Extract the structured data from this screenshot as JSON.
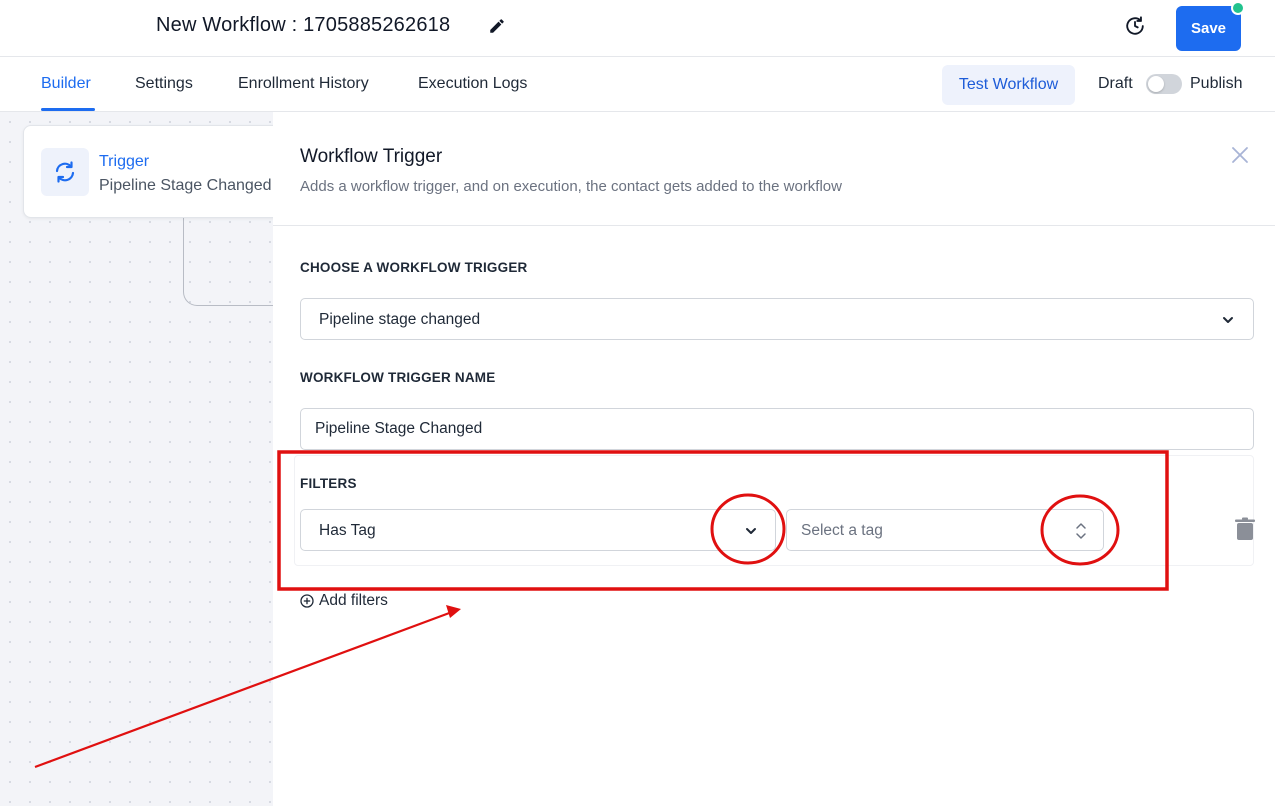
{
  "header": {
    "workflow_title": "New Workflow : 1705885262618",
    "save_label": "Save"
  },
  "tabs": [
    {
      "label": "Builder",
      "active": true
    },
    {
      "label": "Settings",
      "active": false
    },
    {
      "label": "Enrollment History",
      "active": false
    },
    {
      "label": "Execution Logs",
      "active": false
    }
  ],
  "toolbar": {
    "test_workflow_label": "Test Workflow",
    "draft_label": "Draft",
    "publish_label": "Publish",
    "published": false
  },
  "canvas": {
    "trigger_card": {
      "title": "Trigger",
      "subtitle": "Pipeline Stage Changed",
      "icon": "refresh-icon"
    }
  },
  "panel": {
    "title": "Workflow Trigger",
    "description": "Adds a workflow trigger, and on execution, the contact gets added to the workflow",
    "choose_trigger_label": "CHOOSE A WORKFLOW TRIGGER",
    "trigger_value": "Pipeline stage changed",
    "trigger_name_label": "WORKFLOW TRIGGER NAME",
    "trigger_name_value": "Pipeline Stage Changed",
    "filters_label": "FILTERS",
    "filter_type_value": "Has Tag",
    "tag_placeholder": "Select a tag",
    "add_filters_label": "Add filters"
  },
  "colors": {
    "primary": "#1d6cf0",
    "annotation": "#e01010",
    "status_dot": "#22c38e"
  }
}
